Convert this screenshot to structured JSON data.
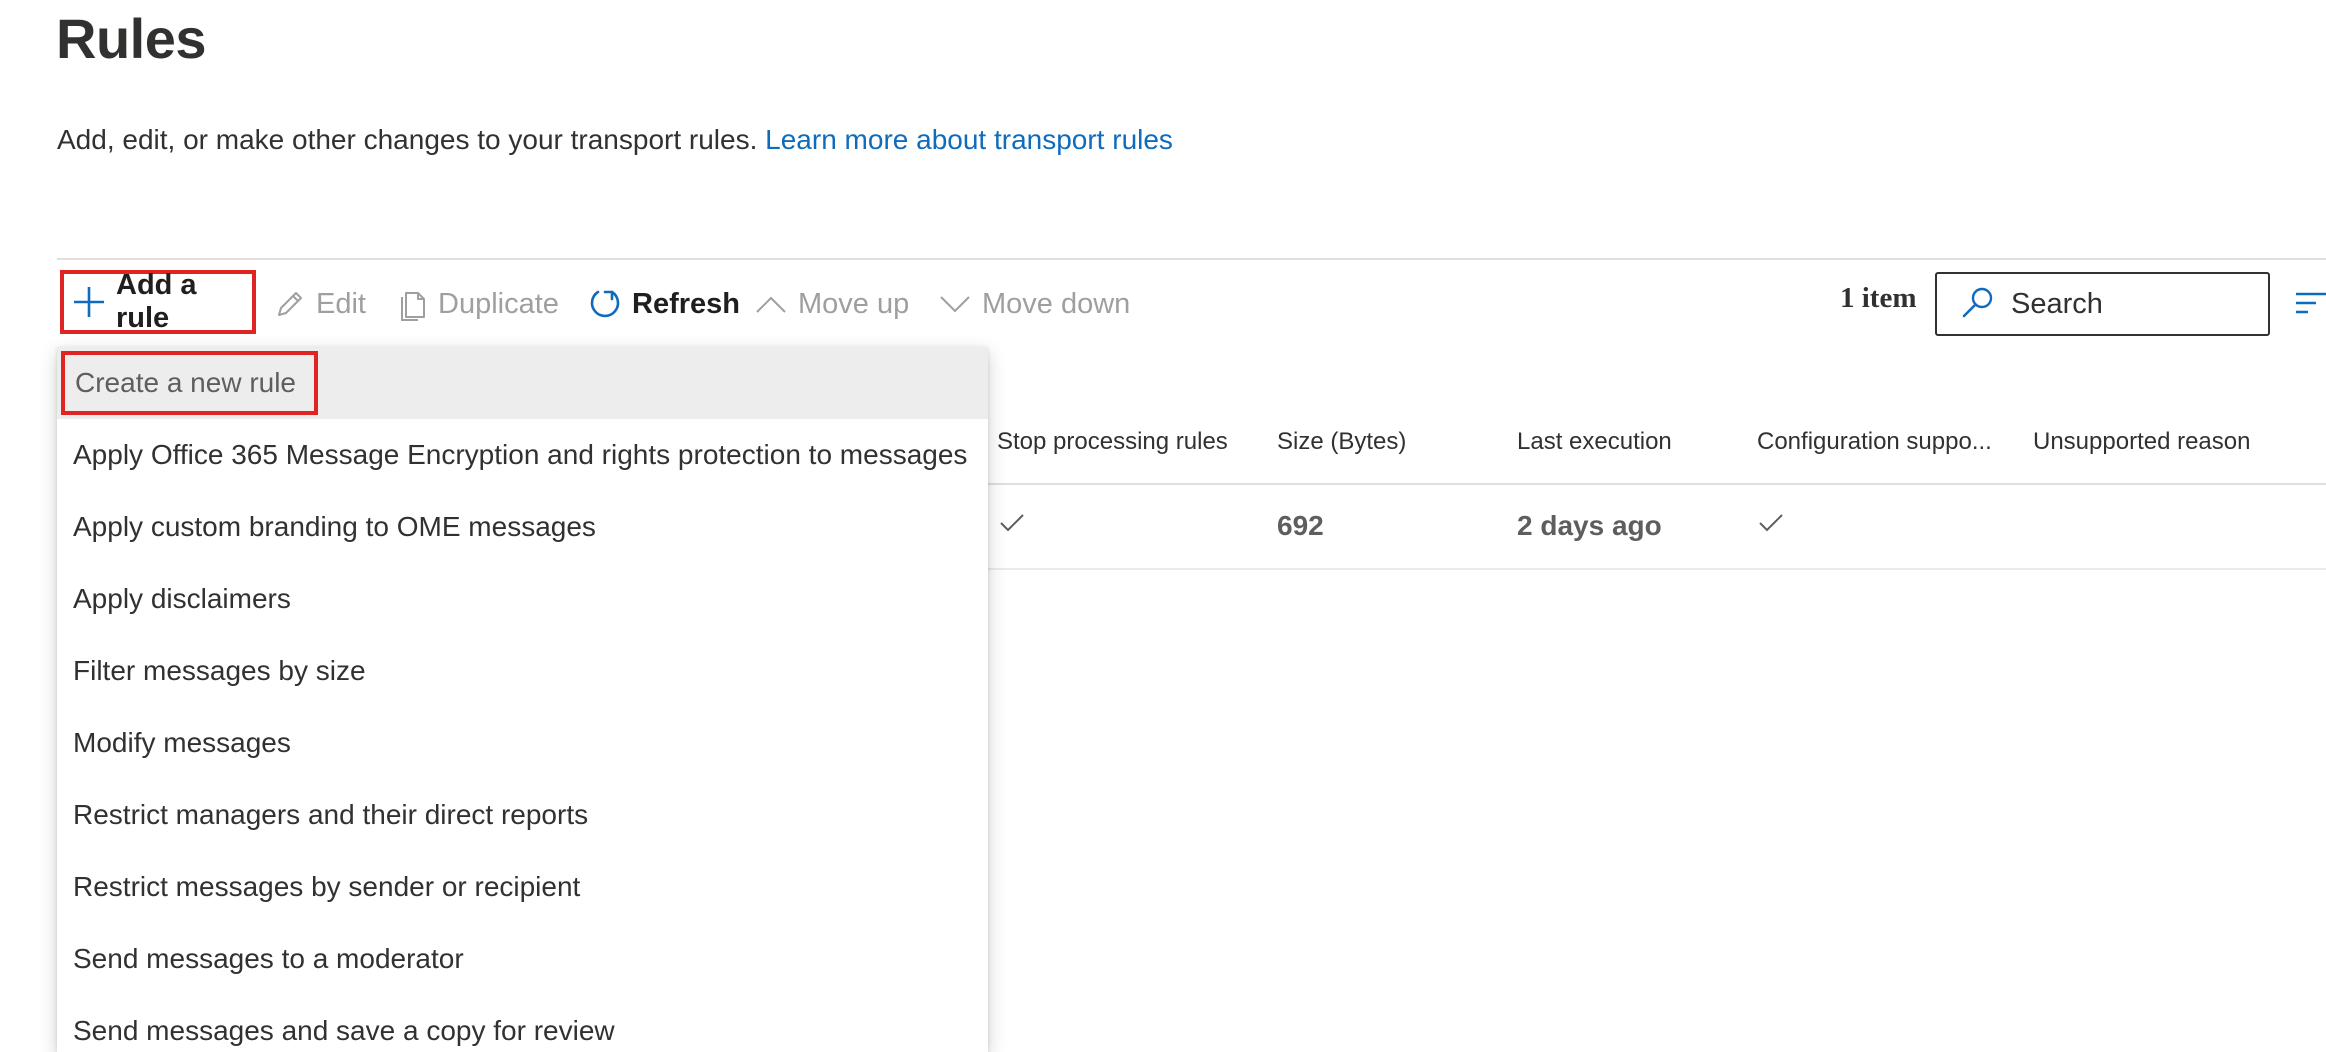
{
  "page": {
    "title": "Rules",
    "subtitle": "Add, edit, or make other changes to your transport rules.",
    "learn_more_link": "Learn more about transport rules"
  },
  "toolbar": {
    "add_rule": "Add a rule",
    "edit": "Edit",
    "duplicate": "Duplicate",
    "refresh": "Refresh",
    "move_up": "Move up",
    "move_down": "Move down",
    "item_count": "1 item",
    "search_placeholder": "Search"
  },
  "table": {
    "columns": [
      "Stop processing rules",
      "Size (Bytes)",
      "Last execution",
      "Configuration suppo...",
      "Unsupported reason"
    ],
    "rows": [
      {
        "size": "692",
        "last_execution": "2 days ago"
      }
    ]
  },
  "dropdown": {
    "items": [
      "Create a new rule",
      "Apply Office 365 Message Encryption and rights protection to messages",
      "Apply custom branding to OME messages",
      "Apply disclaimers",
      "Filter messages by size",
      "Modify messages",
      "Restrict managers and their direct reports",
      "Restrict messages by sender or recipient",
      "Send messages to a moderator",
      "Send messages and save a copy for review"
    ]
  },
  "colors": {
    "accent": "#0f6cbd",
    "highlight_border": "#e02424",
    "disabled_text": "#a19f9d"
  }
}
